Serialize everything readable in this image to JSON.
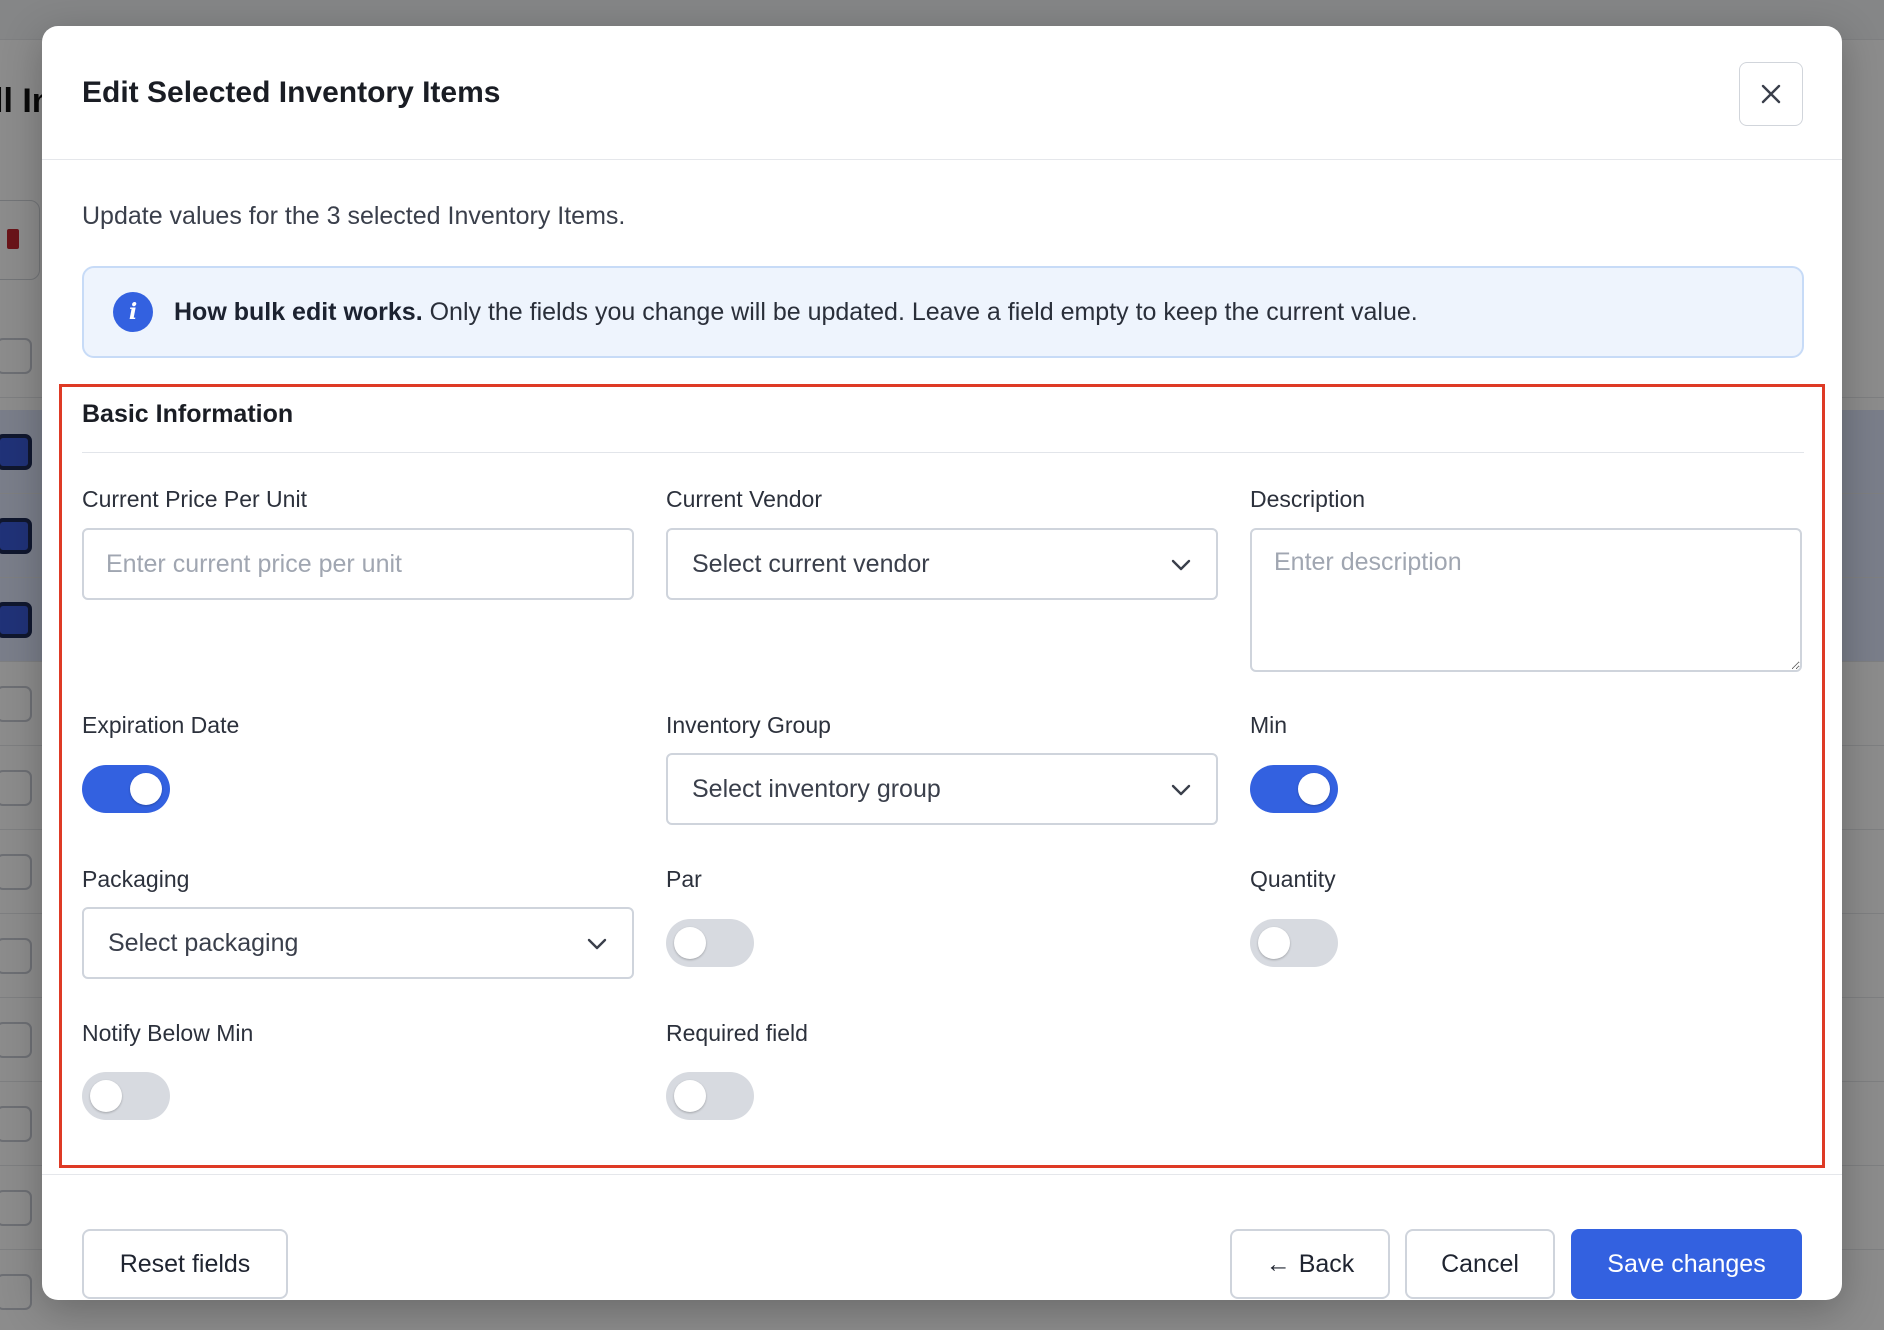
{
  "background": {
    "page_title_fragment": "ll In"
  },
  "modal": {
    "title": "Edit Selected Inventory Items",
    "close_icon": "close-icon",
    "subtitle": "Update values for the 3 selected Inventory Items.",
    "info": {
      "icon": "info-icon",
      "icon_glyph": "i",
      "bold": "How bulk edit works.",
      "text": " Only the fields you change will be updated. Leave a field empty to keep the current value."
    },
    "section": {
      "title": "Basic Information"
    },
    "fields": {
      "current_price": {
        "label": "Current Price Per Unit",
        "value": "",
        "placeholder": "Enter current price per unit"
      },
      "current_vendor": {
        "label": "Current Vendor",
        "value": "Select current vendor",
        "icon": "chevron-down-icon"
      },
      "description": {
        "label": "Description",
        "value": "",
        "placeholder": "Enter description"
      },
      "expiration_date": {
        "label": "Expiration Date",
        "enabled": true
      },
      "inventory_group": {
        "label": "Inventory Group",
        "value": "Select inventory group",
        "icon": "chevron-down-icon"
      },
      "min": {
        "label": "Min",
        "enabled": true
      },
      "packaging": {
        "label": "Packaging",
        "value": "Select packaging",
        "icon": "chevron-down-icon"
      },
      "par": {
        "label": "Par",
        "enabled": false
      },
      "quantity": {
        "label": "Quantity",
        "enabled": false
      },
      "notify_below_min": {
        "label": "Notify Below Min",
        "enabled": false
      },
      "required_field": {
        "label": "Required field",
        "enabled": false
      }
    },
    "footer": {
      "reset_label": "Reset fields",
      "back_arrow": "←",
      "back_label": "Back",
      "cancel_label": "Cancel",
      "save_label": "Save changes"
    }
  },
  "colors": {
    "accent": "#3361e0",
    "highlight_frame": "#de3a25",
    "info_background": "#eef4fd",
    "toggle_off": "#d7dae0"
  }
}
